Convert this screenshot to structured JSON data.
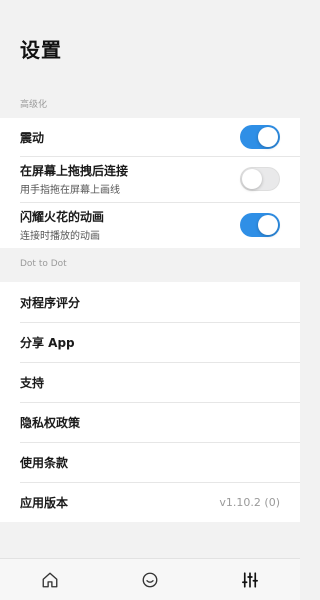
{
  "page": {
    "title": "设置"
  },
  "sections": {
    "personalize": {
      "header": "高级化"
    },
    "dot": {
      "header": "Dot to Dot"
    }
  },
  "settings": {
    "vibration": {
      "label": "震动",
      "enabled": true
    },
    "drag_connect": {
      "label": "在屏幕上拖拽后连接",
      "sub": "用手指拖在屏幕上画线",
      "enabled": false
    },
    "spark_anim": {
      "label": "闪耀火花的动画",
      "sub": "连接时播放的动画",
      "enabled": true
    }
  },
  "menu": {
    "rate": "对程序评分",
    "share": "分享 App",
    "support": "支持",
    "privacy": "隐私权政策",
    "terms": "使用条款",
    "version_label": "应用版本",
    "version_value": "v1.10.2 (0)"
  },
  "tabbar": {
    "icons": [
      "home-icon",
      "smiley-icon",
      "sliders-icon"
    ],
    "active": "sliders-icon"
  },
  "colors": {
    "accent": "#2f8fe6",
    "background": "#f2f2f2"
  }
}
